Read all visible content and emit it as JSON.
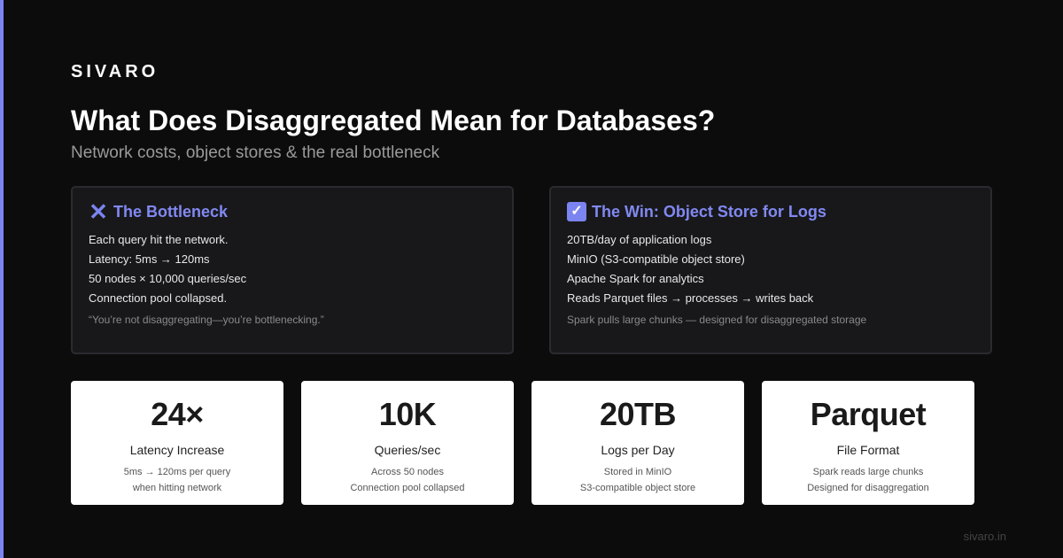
{
  "brand": "SIVARO",
  "title": "What Does Disaggregated Mean for Databases?",
  "subtitle": "Network costs, object stores & the real bottleneck",
  "colors": {
    "accent": "#7b84f0",
    "background": "#0c0c0c",
    "panel": "#18181b",
    "card": "#ffffff"
  },
  "panels": [
    {
      "icon": "cross-mark-icon",
      "title": "The Bottleneck",
      "lines": [
        "Each query hit the network.",
        "Latency: 5ms → 120ms",
        "50 nodes × 10,000 queries/sec",
        "Connection pool collapsed."
      ],
      "note": "“You’re not disaggregating—you’re bottlenecking.”"
    },
    {
      "icon": "check-box-icon",
      "title": "The Win: Object Store for Logs",
      "lines": [
        "20TB/day of application logs",
        "MinIO (S3-compatible object store)",
        "Apache Spark for analytics",
        "Reads Parquet files → processes → writes back"
      ],
      "note": "Spark pulls large chunks — designed for disaggregated storage"
    }
  ],
  "stats": [
    {
      "value": "24×",
      "label": "Latency Increase",
      "detail1": "5ms → 120ms per query",
      "detail2": "when hitting network"
    },
    {
      "value": "10K",
      "label": "Queries/sec",
      "detail1": "Across 50 nodes",
      "detail2": "Connection pool collapsed"
    },
    {
      "value": "20TB",
      "label": "Logs per Day",
      "detail1": "Stored in MinIO",
      "detail2": "S3-compatible object store"
    },
    {
      "value": "Parquet",
      "label": "File Format",
      "detail1": "Spark reads large chunks",
      "detail2": "Designed for disaggregation"
    }
  ],
  "footer": "sivaro.in"
}
